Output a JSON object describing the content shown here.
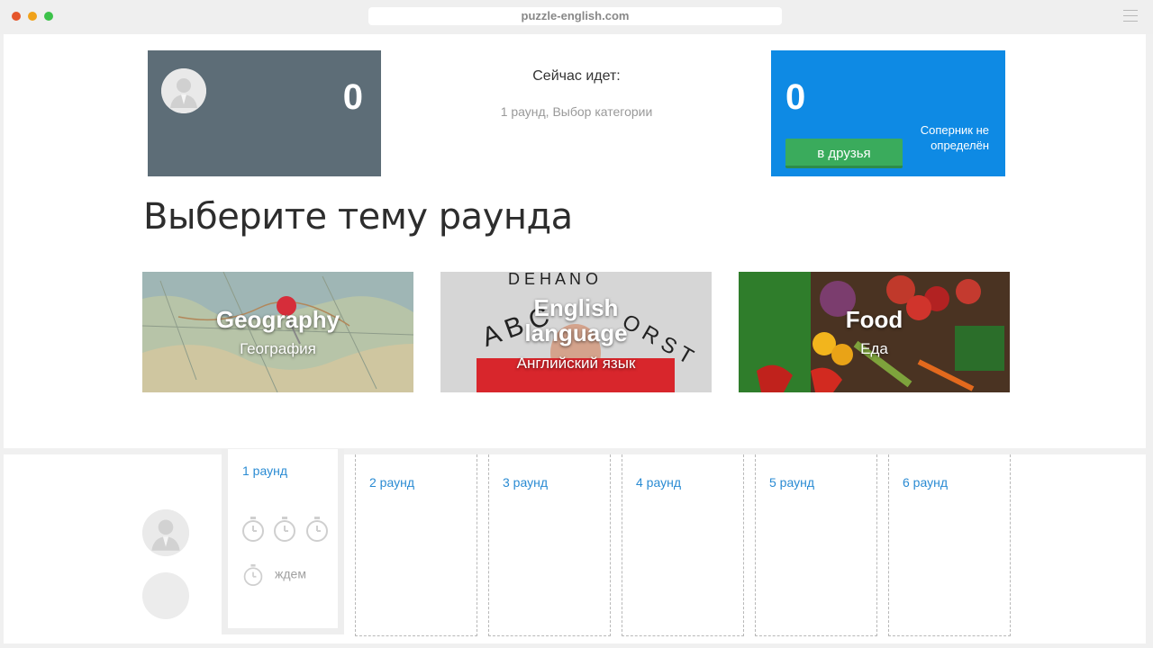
{
  "browser": {
    "url": "puzzle-english.com"
  },
  "player": {
    "score": "0"
  },
  "status": {
    "title": "Сейчас идет:",
    "subtitle": "1 раунд, Выбор категории"
  },
  "opponent": {
    "score": "0",
    "friend_button": "в друзья",
    "text": "Соперник не определён"
  },
  "heading": "Выберите тему раунда",
  "categories": [
    {
      "title": "Geography",
      "subtitle": "География"
    },
    {
      "title": "English language",
      "subtitle": "Английский язык"
    },
    {
      "title": "Food",
      "subtitle": "Еда"
    }
  ],
  "rounds": [
    {
      "label": "1 раунд",
      "status": "ждем"
    },
    {
      "label": "2 раунд"
    },
    {
      "label": "3 раунд"
    },
    {
      "label": "4 раунд"
    },
    {
      "label": "5 раунд"
    },
    {
      "label": "6 раунд"
    }
  ],
  "colors": {
    "player_card": "#5d6d77",
    "opponent_card": "#0e8ae4",
    "friend_button": "#3aab5c",
    "round_label": "#2a8bd3"
  },
  "icons": [
    "user-avatar-icon",
    "stopwatch-icon",
    "menu-icon"
  ]
}
